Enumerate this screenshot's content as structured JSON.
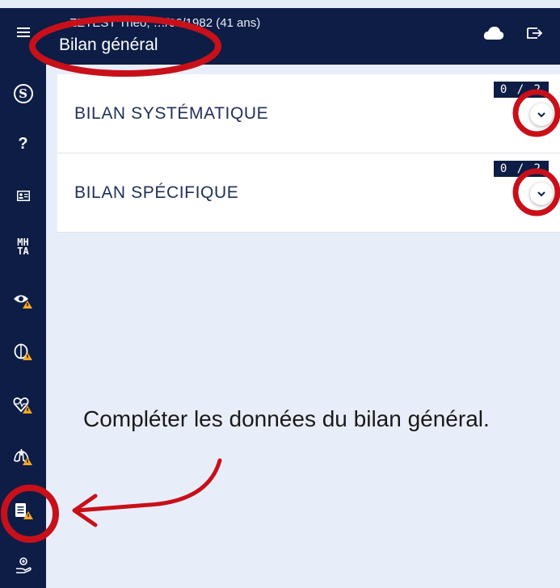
{
  "header": {
    "patient_line": "…ZETEST Théo, …/06/1982 (41 ans)",
    "title": "Bilan général"
  },
  "sidebar": {
    "items": [
      {
        "icon": "menu-icon"
      },
      {
        "icon": "s-circle-icon",
        "label": "S"
      },
      {
        "icon": "question-icon",
        "label": "?"
      },
      {
        "icon": "id-card-icon"
      },
      {
        "icon": "mhta-icon",
        "label_top": "MH",
        "label_bottom": "TA"
      },
      {
        "icon": "eye-warning-icon"
      },
      {
        "icon": "brain-warning-icon"
      },
      {
        "icon": "heart-warning-icon"
      },
      {
        "icon": "lungs-warning-icon"
      },
      {
        "icon": "document-warning-icon",
        "active": true
      },
      {
        "icon": "hand-care-icon"
      }
    ]
  },
  "sections": [
    {
      "label": "BILAN SYSTÉMATIQUE",
      "count": "0 / 2"
    },
    {
      "label": "BILAN SPÉCIFIQUE",
      "count": "0 / 2"
    }
  ],
  "annotation": {
    "text": "Compléter les données du bilan général."
  },
  "colors": {
    "navy": "#0d1d45",
    "background": "#e8eef9",
    "annotation_red": "#c8101a",
    "warning_orange": "#f5a623"
  }
}
